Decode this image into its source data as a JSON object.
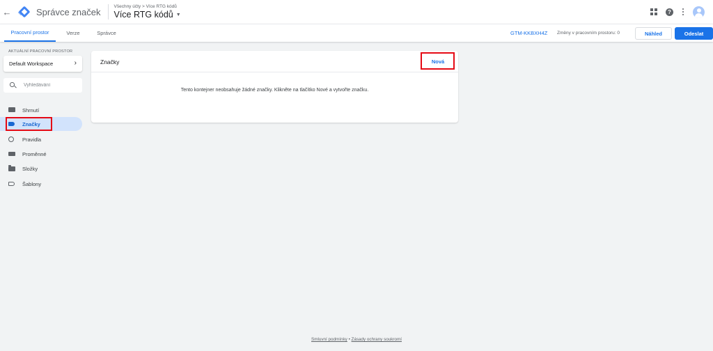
{
  "header": {
    "app_title": "Správce značek",
    "breadcrumb": "Všechny účty > Více RTG kódů",
    "container_name": "Více RTG kódů"
  },
  "tabs": [
    {
      "label": "Pracovní prostor",
      "active": true
    },
    {
      "label": "Verze",
      "active": false
    },
    {
      "label": "Správce",
      "active": false
    }
  ],
  "toolbar": {
    "container_id": "GTM-KKBXH4Z",
    "changes_text": "Změny v pracovním prostoru: 0",
    "preview_label": "Náhled",
    "submit_label": "Odeslat"
  },
  "sidebar": {
    "workspace_label": "AKTUÁLNÍ PRACOVNÍ PROSTOR",
    "workspace_name": "Default Workspace",
    "search_placeholder": "Vyhledávání",
    "items": [
      {
        "label": "Shrnutí",
        "icon": "summary-icon",
        "active": false
      },
      {
        "label": "Značky",
        "icon": "tag-icon",
        "active": true
      },
      {
        "label": "Pravidla",
        "icon": "trigger-icon",
        "active": false
      },
      {
        "label": "Proměnné",
        "icon": "variable-icon",
        "active": false
      },
      {
        "label": "Složky",
        "icon": "folder-icon",
        "active": false
      },
      {
        "label": "Šablony",
        "icon": "template-icon",
        "active": false
      }
    ]
  },
  "main": {
    "card_title": "Značky",
    "new_label": "Nová",
    "empty_message": "Tento kontejner neobsahuje žádné značky. Klikněte na tlačítko Nové a vytvořte značku."
  },
  "footer": {
    "terms": "Smluvní podmínky",
    "separator": "•",
    "privacy": "Zásady ochrany soukromí"
  },
  "colors": {
    "accent": "#1a73e8",
    "highlight": "#e50914",
    "active_nav_bg": "#d2e3fc"
  }
}
